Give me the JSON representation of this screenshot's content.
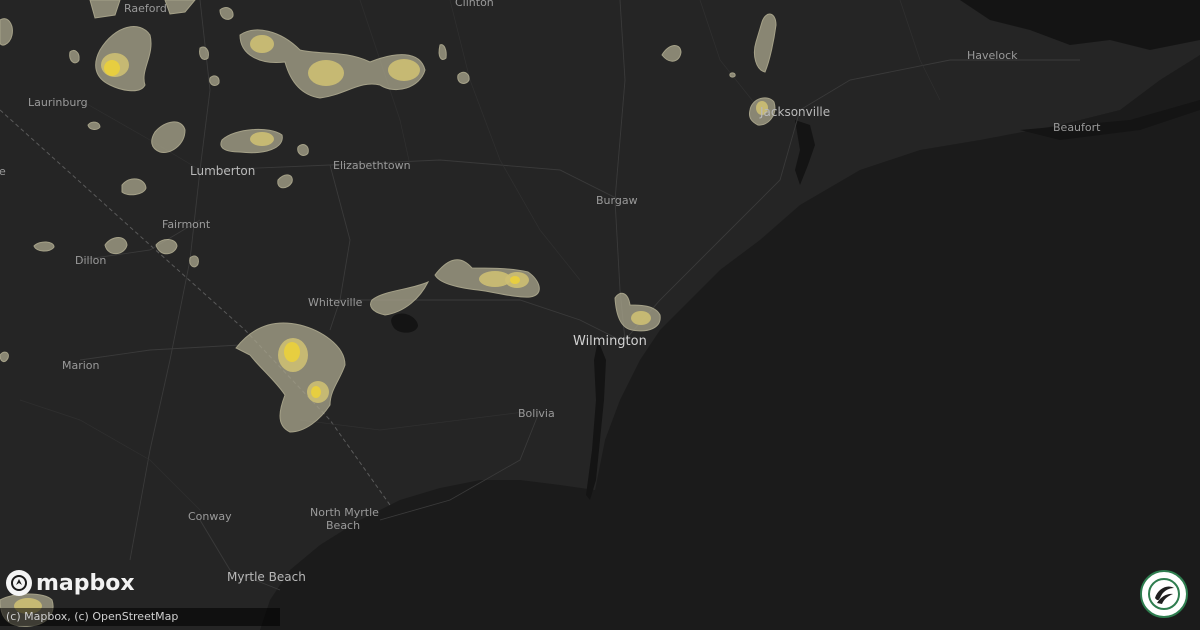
{
  "map": {
    "cities": [
      {
        "id": "raeford",
        "name": "Raeford"
      },
      {
        "id": "clinton",
        "name": "Clinton"
      },
      {
        "id": "laurinburg",
        "name": "Laurinburg"
      },
      {
        "id": "lumberton",
        "name": "Lumberton"
      },
      {
        "id": "elizabethtown",
        "name": "Elizabethtown"
      },
      {
        "id": "fairmont",
        "name": "Fairmont"
      },
      {
        "id": "dillon",
        "name": "Dillon"
      },
      {
        "id": "whiteville",
        "name": "Whiteville"
      },
      {
        "id": "marion",
        "name": "Marion"
      },
      {
        "id": "burgaw",
        "name": "Burgaw"
      },
      {
        "id": "wilmington",
        "name": "Wilmington"
      },
      {
        "id": "bolivia",
        "name": "Bolivia"
      },
      {
        "id": "conway",
        "name": "Conway"
      },
      {
        "id": "north-myrtle-beach-1",
        "name": "North Myrtle"
      },
      {
        "id": "north-myrtle-beach-2",
        "name": "Beach"
      },
      {
        "id": "myrtle-beach",
        "name": "Myrtle Beach"
      },
      {
        "id": "jacksonville",
        "name": "Jacksonville"
      },
      {
        "id": "havelock",
        "name": "Havelock"
      },
      {
        "id": "beaufort",
        "name": "Beaufort"
      },
      {
        "id": "edge-left",
        "name": "le"
      }
    ],
    "colors": {
      "land": "#232323",
      "ocean": "#1b1b1b",
      "storm_light": "#a6a28a",
      "storm_mid": "#cdbf73",
      "storm_core": "#e9cf3d"
    }
  },
  "branding": {
    "logo_icon": "mapbox-logo-icon",
    "logo_text": "mapbox",
    "attribution": "(c) Mapbox, (c) OpenStreetMap",
    "badge_icon": "hail-badge-icon"
  }
}
